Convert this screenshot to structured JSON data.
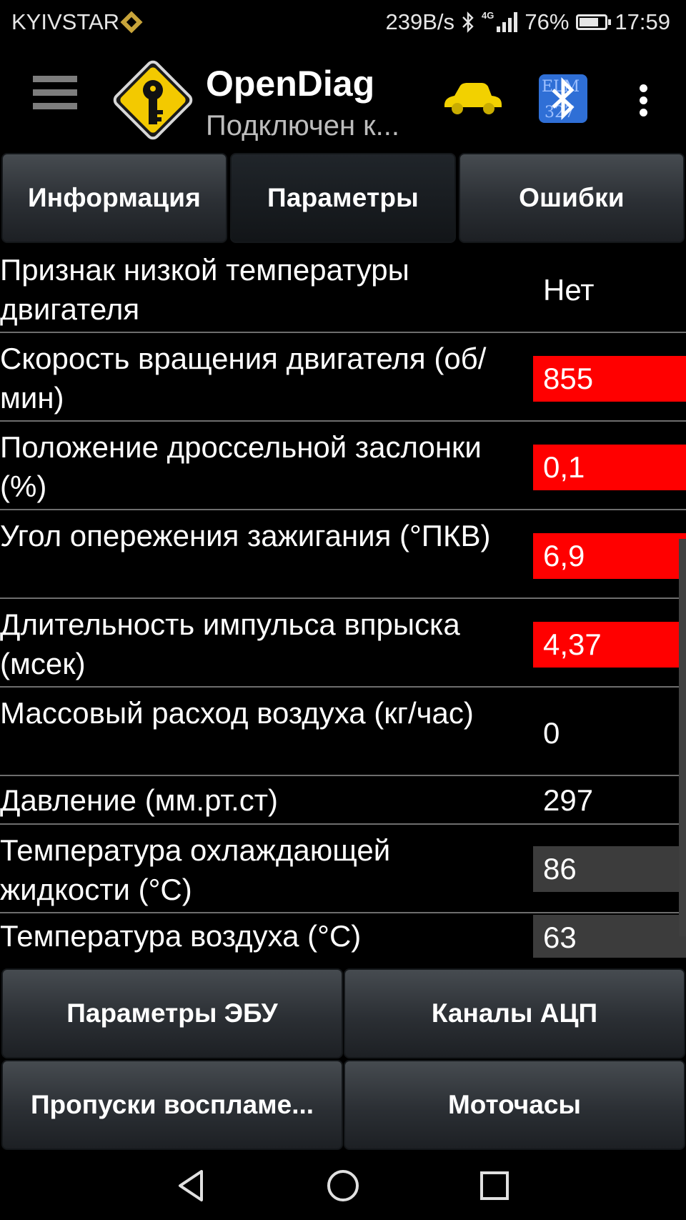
{
  "status_bar": {
    "carrier": "KYIVSTAR",
    "net_speed": "239B/s",
    "network_type": "4G",
    "battery": "76%",
    "battery_level": 0.76,
    "time": "17:59"
  },
  "app_bar": {
    "title": "OpenDiag",
    "subtitle": "Подключен к...",
    "icons": [
      "menu-icon",
      "key-logo-icon",
      "car-icon",
      "elm327-bluetooth-icon",
      "overflow-menu-icon"
    ]
  },
  "tabs": [
    {
      "label": "Информация",
      "active": false
    },
    {
      "label": "Параметры",
      "active": true
    },
    {
      "label": "Ошибки",
      "active": false
    }
  ],
  "parameters": [
    {
      "name": "Признак низкой температуры двигателя",
      "value": "Нет",
      "state": "normal"
    },
    {
      "name": "Скорость вращения двигателя (об/мин)",
      "value": "855",
      "state": "alarm"
    },
    {
      "name": "Положение дроссельной заслонки (%)",
      "value": "0,1",
      "state": "alarm"
    },
    {
      "name": "Угол опережения зажигания (°ПКВ)",
      "value": "6,9",
      "state": "alarm"
    },
    {
      "name": "Длительность импульса впрыска (мсек)",
      "value": "4,37",
      "state": "alarm"
    },
    {
      "name": "Массовый расход воздуха (кг/час)",
      "value": "0",
      "state": "normal"
    },
    {
      "name": "Давление (мм.рт.ст)",
      "value": "297",
      "state": "normal"
    },
    {
      "name": "Температура охлаждающей жидкости (°С)",
      "value": "86",
      "state": "dim"
    },
    {
      "name": "Температура воздуха (°С)",
      "value": "63",
      "state": "dim"
    }
  ],
  "bottom_buttons": [
    {
      "label": "Параметры ЭБУ",
      "active": true
    },
    {
      "label": "Каналы АЦП",
      "active": false
    },
    {
      "label": "Пропуски воспламе...",
      "active": false
    },
    {
      "label": "Моточасы",
      "active": false
    }
  ],
  "colors": {
    "alarm": "#ff0000",
    "dim_value": "#3c3c3c",
    "car_yellow": "#f2d100",
    "bluetooth_blue": "#2f6fd6"
  }
}
